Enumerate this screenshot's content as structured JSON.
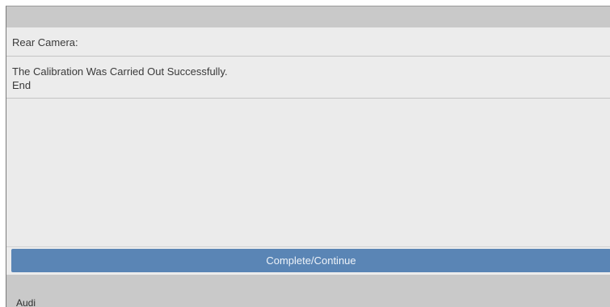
{
  "title_row": {
    "label": "Rear Camera:"
  },
  "message": {
    "line1": "The Calibration Was Carried Out Successfully.",
    "line2": "End"
  },
  "actions": {
    "continue_label": "Complete/Continue"
  },
  "footer": {
    "brand": "Audi"
  },
  "colors": {
    "button": "#5a85b5",
    "bars": "#c9c9c9",
    "panel": "#ececec"
  }
}
